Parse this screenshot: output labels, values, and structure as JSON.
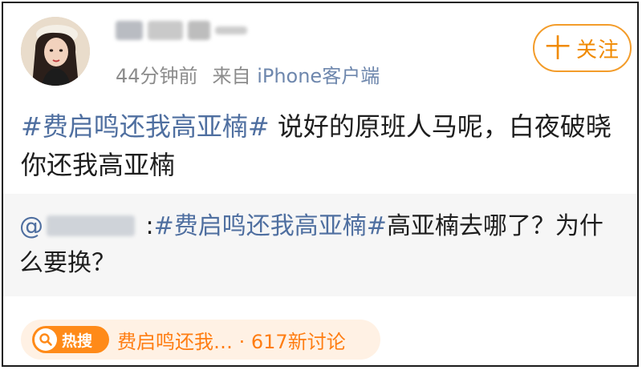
{
  "post": {
    "meta": {
      "time": "44分钟前",
      "source_label": "来自",
      "source": "iPhone客户端"
    },
    "follow_button": {
      "plus": "十",
      "label": "关注"
    },
    "hashtag": "#费启鸣还我高亚楠#",
    "body": " 说好的原班人马呢，白夜破晓你还我高亚楠"
  },
  "quote": {
    "at": "@",
    "separator": " :",
    "hashtag": "#费启鸣还我高亚楠#",
    "body": "高亚楠去哪了？为什么要换？"
  },
  "hot_search": {
    "badge": "热搜",
    "text": "费启鸣还我… · 617新讨论"
  },
  "colors": {
    "link": "#4f6fa0",
    "accent": "#f08a00",
    "hot": "#ff8a18"
  },
  "icons": {
    "hot_badge": "magnifier-icon",
    "avatar": "avatar-illustration"
  }
}
